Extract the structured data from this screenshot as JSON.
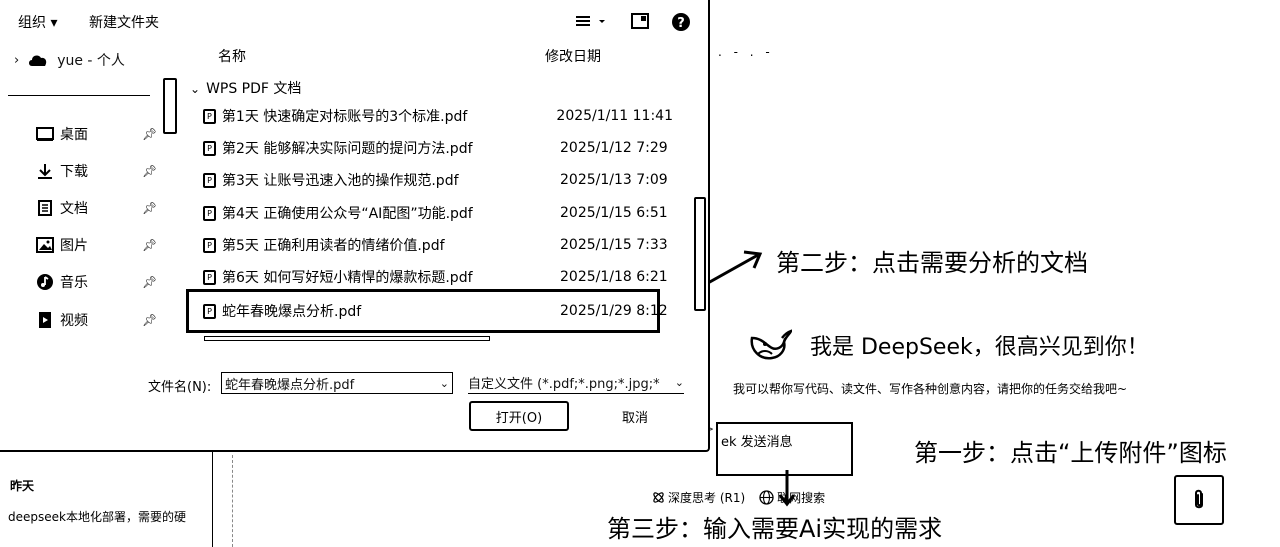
{
  "dialog": {
    "toolbar": {
      "organize_label": "组织 ▾",
      "new_folder_label": "新建文件夹",
      "view_icon": "list-view-icon",
      "pane_icon": "preview-pane-icon",
      "help_icon": "help-icon"
    },
    "nav": {
      "cloud_label": "yue - 个人",
      "items": [
        {
          "label": "桌面",
          "icon": "desktop-icon"
        },
        {
          "label": "下载",
          "icon": "download-icon"
        },
        {
          "label": "文档",
          "icon": "document-icon"
        },
        {
          "label": "图片",
          "icon": "picture-icon"
        },
        {
          "label": "音乐",
          "icon": "music-icon"
        },
        {
          "label": "视频",
          "icon": "video-icon"
        }
      ]
    },
    "columns": {
      "name": "名称",
      "modified": "修改日期"
    },
    "group_label": "WPS PDF 文档",
    "files": [
      {
        "name": "第1天 快速确定对标账号的3个标准.pdf",
        "date": "2025/1/11 11:41"
      },
      {
        "name": "第2天 能够解决实际问题的提问方法.pdf",
        "date": "2025/1/12 7:29"
      },
      {
        "name": "第3天 让账号迅速入池的操作规范.pdf",
        "date": "2025/1/13 7:09"
      },
      {
        "name": "第4天  正确使用公众号“AI配图”功能.pdf",
        "date": "2025/1/15 6:51"
      },
      {
        "name": "第5天  正确利用读者的情绪价值.pdf",
        "date": "2025/1/15 7:33"
      },
      {
        "name": "第6天 如何写好短小精悍的爆款标题.pdf",
        "date": "2025/1/18 6:21"
      },
      {
        "name": "蛇年春晚爆点分析.pdf",
        "date": "2025/1/29 8:12"
      }
    ],
    "filename_label": "文件名(N):",
    "filename_value": "蛇年春晚爆点分析.pdf",
    "filetype_value": "自定义文件 (*.pdf;*.png;*.jpg;*",
    "open_button": "打开(O)",
    "cancel_button": "取消"
  },
  "deepseek": {
    "greeting": "我是 DeepSeek，很高兴见到你！",
    "subtitle": "我可以帮你写代码、读文件、写作各种创意内容，请把你的任务交给我吧~",
    "input_placeholder": "ek 发送消息",
    "deep_think": "深度思考 (R1)",
    "web_search": "联网搜索",
    "history_label": "昨天",
    "history_item": "deepseek本地化部署，需要的硬",
    "dots": ". - . -"
  },
  "annotations": {
    "step1": "第一步：点击“上传附件”图标",
    "step2": "第二步：点击需要分析的文档",
    "step3": "第三步：输入需要Ai实现的需求"
  }
}
